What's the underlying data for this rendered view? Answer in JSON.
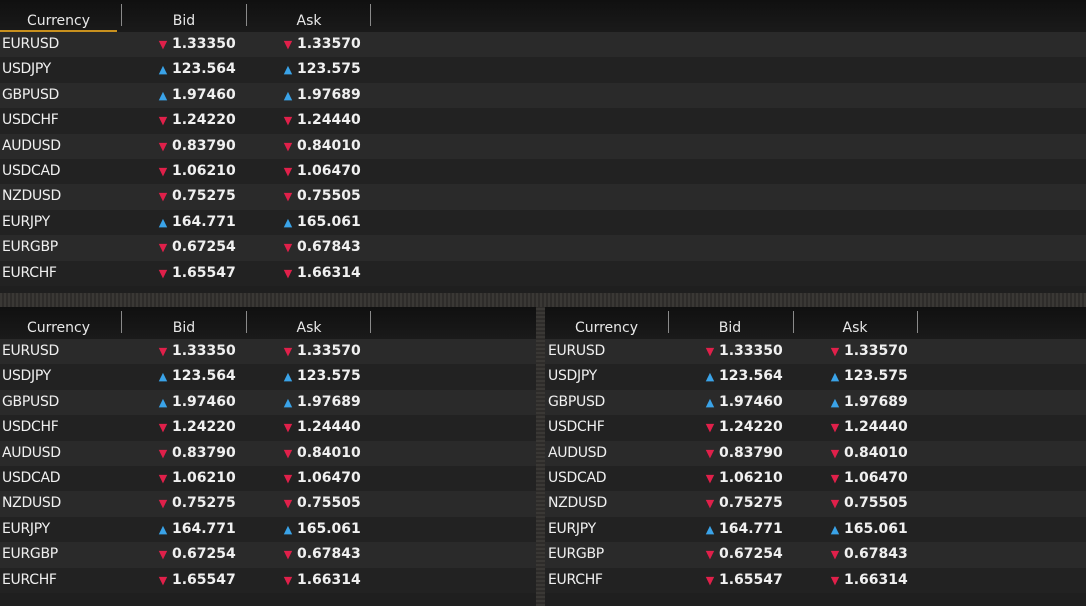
{
  "headers": {
    "currency": "Currency",
    "bid": "Bid",
    "ask": "Ask"
  },
  "rows": [
    {
      "currency": "EURUSD",
      "bid": "1.33350",
      "ask": "1.33570",
      "dir": "down"
    },
    {
      "currency": "USDJPY",
      "bid": "123.564",
      "ask": "123.575",
      "dir": "up"
    },
    {
      "currency": "GBPUSD",
      "bid": "1.97460",
      "ask": "1.97689",
      "dir": "up"
    },
    {
      "currency": "USDCHF",
      "bid": "1.24220",
      "ask": "1.24440",
      "dir": "down"
    },
    {
      "currency": "AUDUSD",
      "bid": "0.83790",
      "ask": "0.84010",
      "dir": "down"
    },
    {
      "currency": "USDCAD",
      "bid": "1.06210",
      "ask": "1.06470",
      "dir": "down"
    },
    {
      "currency": "NZDUSD",
      "bid": "0.75275",
      "ask": "0.75505",
      "dir": "down"
    },
    {
      "currency": "EURJPY",
      "bid": "164.771",
      "ask": "165.061",
      "dir": "up"
    },
    {
      "currency": "EURGBP",
      "bid": "0.67254",
      "ask": "0.67843",
      "dir": "down"
    },
    {
      "currency": "EURCHF",
      "bid": "1.65547",
      "ask": "1.66314",
      "dir": "down"
    }
  ],
  "icons": {
    "up": "arrow-up-icon",
    "down": "arrow-down-icon"
  },
  "colors": {
    "up": "#3aa3e8",
    "down": "#e0204a",
    "selected_header": "#c8901e"
  }
}
